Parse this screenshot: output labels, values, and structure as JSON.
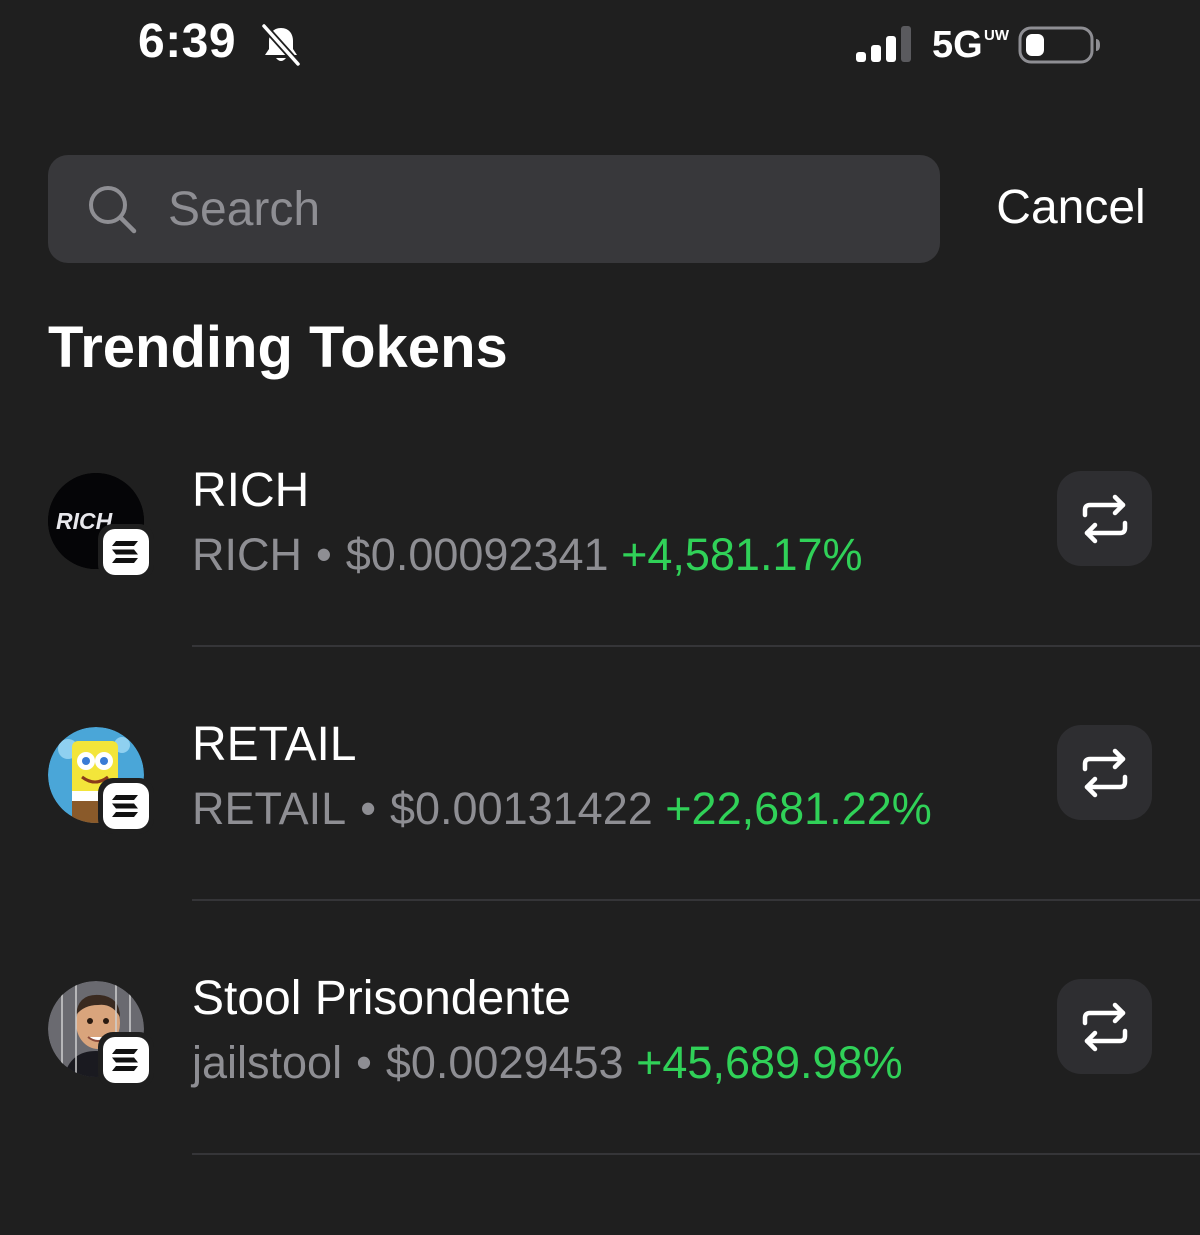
{
  "status_bar": {
    "time": "6:39",
    "network": "5G",
    "network_sub": "UW",
    "icons": [
      "bell-slash-icon",
      "cellular-signal-icon",
      "battery-icon"
    ]
  },
  "search": {
    "placeholder": "Search",
    "value": "",
    "cancel_label": "Cancel"
  },
  "section": {
    "title": "Trending Tokens"
  },
  "tokens": [
    {
      "name": "RICH",
      "symbol": "RICH",
      "separator": "•",
      "price": "$0.00092341",
      "change": "+4,581.17%",
      "avatar_text": "RICH"
    },
    {
      "name": "RETAIL",
      "symbol": "RETAIL",
      "separator": "•",
      "price": "$0.00131422",
      "change": "+22,681.22%"
    },
    {
      "name": "Stool Prisondente",
      "symbol": "jailstool",
      "separator": "•",
      "price": "$0.0029453",
      "change": "+45,689.98%"
    }
  ],
  "colors": {
    "background": "#1f1f1f",
    "search_bg": "#38383b",
    "secondary_text": "#8e8e93",
    "positive": "#30d158",
    "button_bg": "#2e2e31"
  }
}
